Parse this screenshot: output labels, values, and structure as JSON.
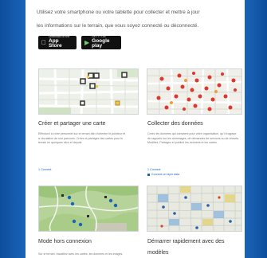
{
  "intro": {
    "line1": "Utilisez votre smartphone ou votre tablette pour collecter et mettre à jour",
    "line2": "les informations sur le terrain, que vous soyez connecté ou déconnecté."
  },
  "badges": {
    "app_store_small": "Download on the",
    "app_store": "App Store",
    "google_play_small": "GET IT ON",
    "google_play": "Google play"
  },
  "cards": [
    {
      "title": "Créer et partager une carte",
      "desc": "Effectuez à votre personnel sur le terrain afin d'orienter le pointeur et à circulation de son parcours. Créez et partagez des cartes pour le terrain en quelques clics et depuis.",
      "link": "1 Connect"
    },
    {
      "title": "Collecter des données",
      "desc": "Créez les données qui comptent pour votre organisation, qu'il s'agisse de rapports sur les dommages, de demandes de services ou de relevés. Modifiez, Partagez et publiez les données et les cartes.",
      "link": "1 Connect",
      "link2": "Connect un layer data"
    },
    {
      "title": "Mode hors connexion",
      "desc": "Sur le terrain, travaillez avec les cartes, les données et les images."
    },
    {
      "title": "Démarrer rapidement avec des",
      "title2": "modèles",
      "desc": ""
    }
  ]
}
